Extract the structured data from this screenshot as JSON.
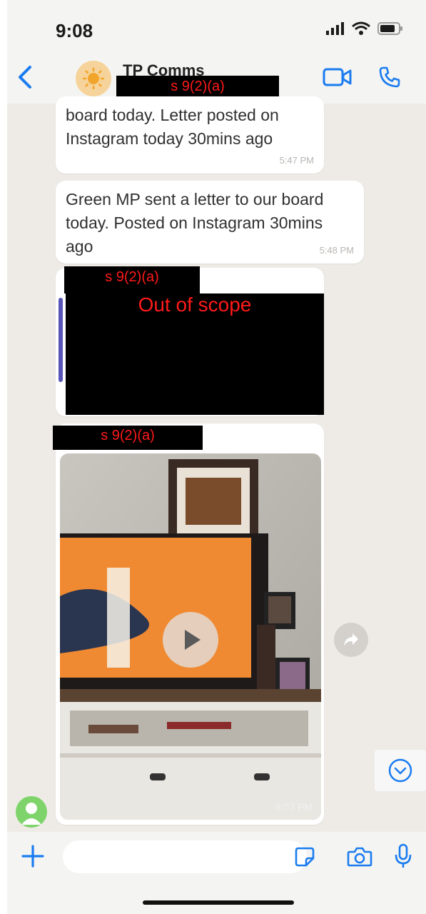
{
  "status_bar": {
    "time": "9:08"
  },
  "header": {
    "chat_name": "TP Comms",
    "redaction": "s 9(2)(a)"
  },
  "messages": [
    {
      "text": "board today. Letter posted on Instagram today 30mins ago",
      "time": "5:47 PM"
    },
    {
      "text": "Green MP sent a letter to our board today. Posted on Instagram 30mins ago",
      "time": "5:48 PM"
    },
    {
      "sender_redaction": "s 9(2)(a)",
      "body_redaction": "Out of scope"
    },
    {
      "sender_redaction": "s 9(2)(a)",
      "type": "video",
      "time": "6:07 PM"
    }
  ],
  "composer": {
    "placeholder": ""
  },
  "icons": {
    "back": "chevron-left-icon",
    "video": "video-camera-icon",
    "call": "phone-icon",
    "forward": "forward-icon",
    "scroll": "chevron-down-circle-icon",
    "plus": "plus-icon",
    "sticker": "sticker-icon",
    "camera": "camera-icon",
    "mic": "microphone-icon"
  },
  "colors": {
    "accent": "#1a7cf0",
    "redaction_text": "#ff1a1a",
    "chat_bg": "#eeebe6"
  }
}
